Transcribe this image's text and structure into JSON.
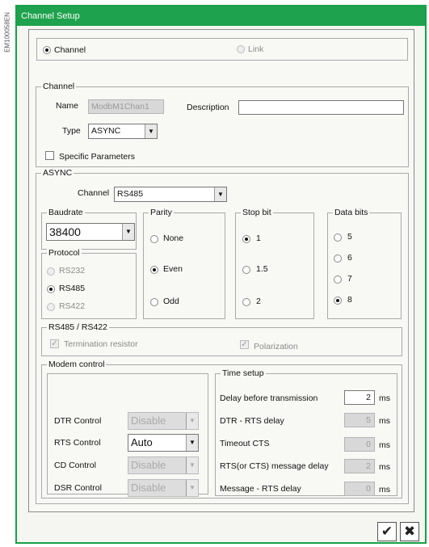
{
  "side_label": "EM100058EN",
  "window": {
    "title": "Channel Setup"
  },
  "mode": {
    "channel": "Channel",
    "link": "Link"
  },
  "channel": {
    "legend": "Channel",
    "name_label": "Name",
    "name_value": "ModbM1Chan1",
    "description_label": "Description",
    "description_value": "",
    "type_label": "Type",
    "type_value": "ASYNC",
    "specific_label": "Specific Parameters"
  },
  "async": {
    "legend": "ASYNC",
    "channel_label": "Channel",
    "channel_value": "RS485",
    "baudrate": {
      "legend": "Baudrate",
      "value": "38400"
    },
    "protocol": {
      "legend": "Protocol",
      "options": [
        "RS232",
        "RS485",
        "RS422"
      ],
      "selected": "RS485"
    },
    "parity": {
      "legend": "Parity",
      "options": [
        "None",
        "Even",
        "Odd"
      ],
      "selected": "Even"
    },
    "stop_bit": {
      "legend": "Stop bit",
      "options": [
        "1",
        "1.5",
        "2"
      ],
      "selected": "1"
    },
    "data_bits": {
      "legend": "Data bits",
      "options": [
        "5",
        "6",
        "7",
        "8"
      ],
      "selected": "8"
    },
    "rs485": {
      "legend": "RS485 / RS422",
      "termination": "Termination resistor",
      "polarization": "Polarization"
    },
    "modem": {
      "legend": "Modem control",
      "dtr_label": "DTR Control",
      "dtr_value": "Disable",
      "rts_label": "RTS Control",
      "rts_value": "Auto",
      "cd_label": "CD Control",
      "cd_value": "Disable",
      "dsr_label": "DSR Control",
      "dsr_value": "Disable"
    },
    "time": {
      "legend": "Time setup",
      "rows": [
        {
          "label": "Delay before transmission",
          "value": "2",
          "unit": "ms"
        },
        {
          "label": "DTR - RTS delay",
          "value": "5",
          "unit": "ms"
        },
        {
          "label": "Timeout CTS",
          "value": "0",
          "unit": "ms"
        },
        {
          "label": "RTS(or CTS) message delay",
          "value": "2",
          "unit": "ms"
        },
        {
          "label": "Message - RTS delay",
          "value": "0",
          "unit": "ms"
        }
      ]
    }
  },
  "buttons": {
    "ok_glyph": "✔",
    "cancel_glyph": "✖"
  },
  "icons": {
    "ok": "checkmark-icon",
    "cancel": "cancel-x-icon",
    "dropdown": "chevron-down-icon"
  },
  "colors": {
    "titlebar": "#1ea24d",
    "border": "#17a149"
  }
}
